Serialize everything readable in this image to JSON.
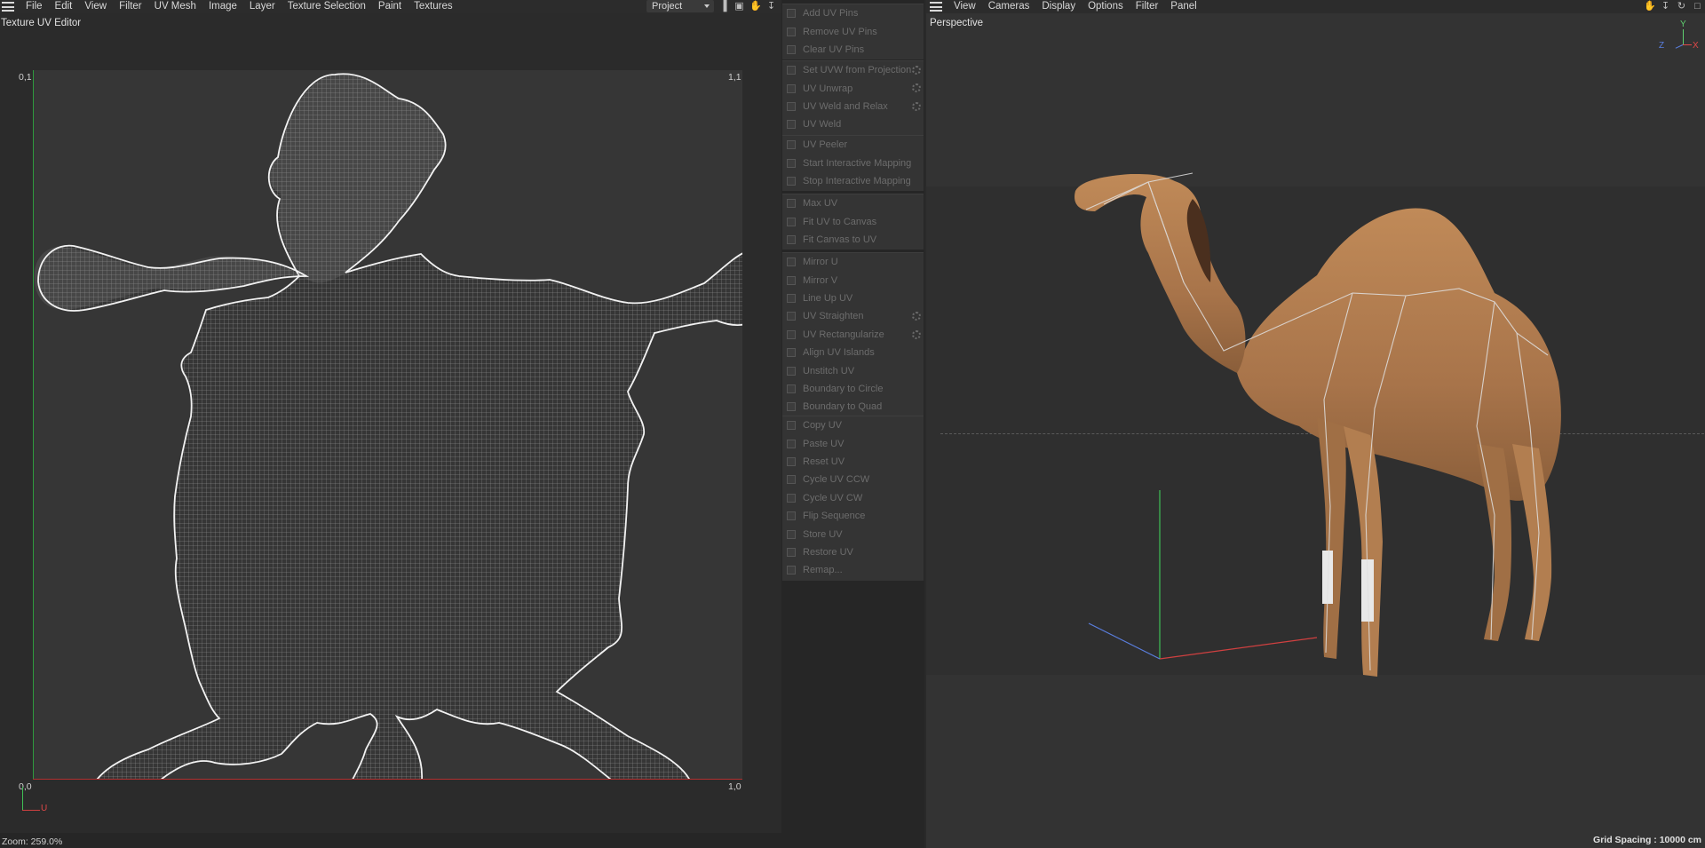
{
  "uv_editor": {
    "menu": [
      "File",
      "Edit",
      "View",
      "Filter",
      "UV Mesh",
      "Image",
      "Layer",
      "Texture Selection",
      "Paint",
      "Textures"
    ],
    "project_select": "Project",
    "title": "Texture UV Editor",
    "corner_labels": {
      "top_left": "0,1",
      "top_right": "1,1",
      "bottom_left": "0,0",
      "bottom_right": "1,0"
    },
    "gizmo_u_label": "U",
    "zoom": "Zoom: 259.0%"
  },
  "commands": {
    "groups": [
      [
        "Add UV Pins",
        "Remove UV Pins",
        "Clear UV Pins"
      ],
      [
        "Set UVW from Projection",
        "UV Unwrap",
        "UV Weld and Relax",
        "UV Weld"
      ],
      [
        "UV Peeler",
        "Start Interactive Mapping",
        "Stop Interactive Mapping"
      ],
      [
        "Max UV",
        "Fit UV to Canvas",
        "Fit Canvas to UV"
      ],
      [
        "Mirror U",
        "Mirror V",
        "Line Up UV",
        "UV Straighten",
        "UV Rectangularize",
        "Align UV Islands",
        "Unstitch UV",
        "Boundary to Circle",
        "Boundary to Quad"
      ],
      [
        "Copy UV",
        "Paste UV",
        "Reset UV",
        "Cycle UV CCW",
        "Cycle UV CW",
        "Flip Sequence",
        "Store UV",
        "Restore UV",
        "Remap..."
      ]
    ],
    "has_settings": [
      "Set UVW from Projection",
      "UV Unwrap",
      "UV Weld and Relax",
      "UV Straighten",
      "UV Rectangularize"
    ]
  },
  "viewport": {
    "menu": [
      "View",
      "Cameras",
      "Display",
      "Options",
      "Filter",
      "Panel"
    ],
    "title": "Perspective",
    "axis_labels": {
      "y": "Y",
      "x": "X",
      "z": "Z"
    },
    "grid_spacing": "Grid Spacing : 10000 cm"
  },
  "colors": {
    "accent_green": "#2e9a3e",
    "accent_red": "#b23030",
    "camel_body": "#b07a4a",
    "uv_fill": "#555555"
  }
}
